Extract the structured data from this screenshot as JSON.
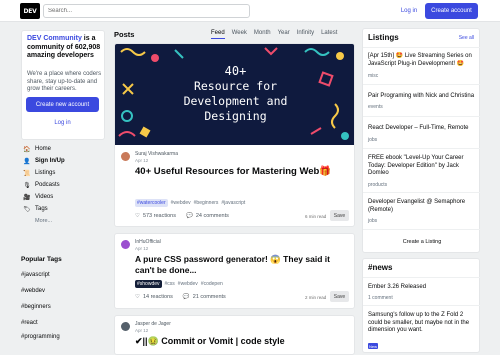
{
  "topbar": {
    "logo": "DEV",
    "search_placeholder": "Search...",
    "login": "Log in",
    "create_account": "Create account"
  },
  "intro": {
    "brand": "DEV Community",
    "headline_rest": " is a community of 602,908 amazing developers",
    "description": "We're a place where coders share, stay up-to-date and grow their careers.",
    "create_account": "Create new account",
    "login": "Log in"
  },
  "nav": {
    "items": [
      {
        "label": "Home",
        "icon": "house-icon",
        "glyph": "🏠"
      },
      {
        "label": "Sign In/Up",
        "icon": "user-icon",
        "glyph": "👤"
      },
      {
        "label": "Listings",
        "icon": "scroll-icon",
        "glyph": "📜"
      },
      {
        "label": "Podcasts",
        "icon": "microphone-icon",
        "glyph": "🎙"
      },
      {
        "label": "Videos",
        "icon": "video-camera-icon",
        "glyph": "🎥"
      },
      {
        "label": "Tags",
        "icon": "tag-icon",
        "glyph": "🏷"
      }
    ],
    "more": "More..."
  },
  "popular_tags": {
    "title": "Popular Tags",
    "tags": [
      "#javascript",
      "#webdev",
      "#beginners",
      "#react",
      "#programming"
    ]
  },
  "feed": {
    "title": "Posts",
    "tabs": [
      "Feed",
      "Week",
      "Month",
      "Year",
      "Infinity",
      "Latest"
    ],
    "active_tab": "Feed",
    "posts": [
      {
        "cover_text": "40+\nResource for\nDevelopment and\nDesigning",
        "author": "Suraj Vishwakarma",
        "date": "Apr 12",
        "title": "40+ Useful Resources for Mastering Web🎁",
        "tags": [
          "#watercooler",
          "#webdev",
          "#beginners",
          "#javascript"
        ],
        "reactions": "573  reactions",
        "comments": "24  comments",
        "read_time": "6 min read",
        "save": "Save"
      },
      {
        "author": "InHuOfficial",
        "date": "Apr 12",
        "title": "A pure CSS password generator! 😱 They said it can't be done...",
        "tags": [
          "#showdev",
          "#css",
          "#webdev",
          "#codepen"
        ],
        "reactions": "14  reactions",
        "comments": "21  comments",
        "read_time": "2 min read",
        "save": "Save"
      },
      {
        "author": "Jasper de Jager",
        "date": "Apr 12",
        "title": "✔||🤢 Commit or Vomit | code style"
      }
    ]
  },
  "listings": {
    "title": "Listings",
    "see_all": "See all",
    "items": [
      {
        "title": "[Apr 15th] 🤩 Live Streaming Series on JavaScript Plug-in Development! 🤩",
        "category": "misc"
      },
      {
        "title": "Pair Programing with Nick and Christina",
        "category": "events"
      },
      {
        "title": "React Developer – Full-Time, Remote",
        "category": "jobs"
      },
      {
        "title": "FREE ebook \"Level-Up Your Career Today: Developer Edition\" by Jack Domleo",
        "category": "products"
      },
      {
        "title": "Developer Evangelist @ Semaphore (Remote)",
        "category": "jobs"
      }
    ],
    "create": "Create a Listing"
  },
  "news": {
    "title": "#news",
    "items": [
      {
        "title": "Ember 3.26 Released",
        "meta": "1 comment"
      },
      {
        "title": "Samsung's follow up to the Z Fold 2 could be smaller, but maybe not in the dimension you want.",
        "meta": "New"
      }
    ]
  }
}
